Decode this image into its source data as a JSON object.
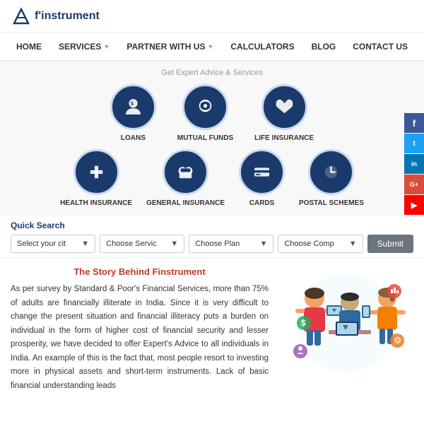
{
  "header": {
    "logo_text": "f'instrument",
    "logo_f": "F"
  },
  "nav": {
    "items": [
      {
        "label": "HOME",
        "has_arrow": false
      },
      {
        "label": "SERVICES",
        "has_arrow": true
      },
      {
        "label": "PARTNER WITH US",
        "has_arrow": true
      },
      {
        "label": "CALCULATORS",
        "has_arrow": false
      },
      {
        "label": "BLOG",
        "has_arrow": false
      },
      {
        "label": "CONTACT US",
        "has_arrow": false
      }
    ]
  },
  "services": {
    "subtitle": "Get Expert Advice & Services",
    "row1": [
      {
        "label": "LOANS",
        "icon": "loans"
      },
      {
        "label": "MUTUAL FUNDS",
        "icon": "mutual-funds"
      },
      {
        "label": "LIFE INSURANCE",
        "icon": "life-insurance"
      }
    ],
    "row2": [
      {
        "label": "HEALTH INSURANCE",
        "icon": "health-insurance"
      },
      {
        "label": "GENERAL INSURANCE",
        "icon": "general-insurance"
      },
      {
        "label": "CARDS",
        "icon": "cards"
      },
      {
        "label": "POSTAL SCHEMES",
        "icon": "postal-schemes"
      }
    ]
  },
  "quick_search": {
    "label": "Quick Search",
    "dropdowns": [
      {
        "placeholder": "Select your cit"
      },
      {
        "placeholder": "Choose Servic"
      },
      {
        "placeholder": "Choose Plan"
      },
      {
        "placeholder": "Choose Comp"
      }
    ],
    "submit_label": "Submit"
  },
  "story": {
    "title": "The Story Behind Finstrument",
    "text": "As per survey by Standard & Poor's Financial Services, more than 75% of adults are financially illiterate in India. Since it is very difficult to change the present situation and financial illiteracy puts a burden on individual in the form of higher cost of financial security and lesser prosperity, we have decided to offer Expert's Advice to all individuals in India. An example of this is the fact that, most people resort to investing more in physical assets and short-term instruments. Lack of basic financial understanding leads"
  },
  "social": {
    "items": [
      {
        "label": "f",
        "name": "facebook",
        "class": "social-fb"
      },
      {
        "label": "t",
        "name": "twitter",
        "class": "social-tw"
      },
      {
        "label": "in",
        "name": "linkedin",
        "class": "social-li"
      },
      {
        "label": "G+",
        "name": "google-plus",
        "class": "social-gp"
      },
      {
        "label": "▶",
        "name": "youtube",
        "class": "social-yt"
      }
    ]
  }
}
